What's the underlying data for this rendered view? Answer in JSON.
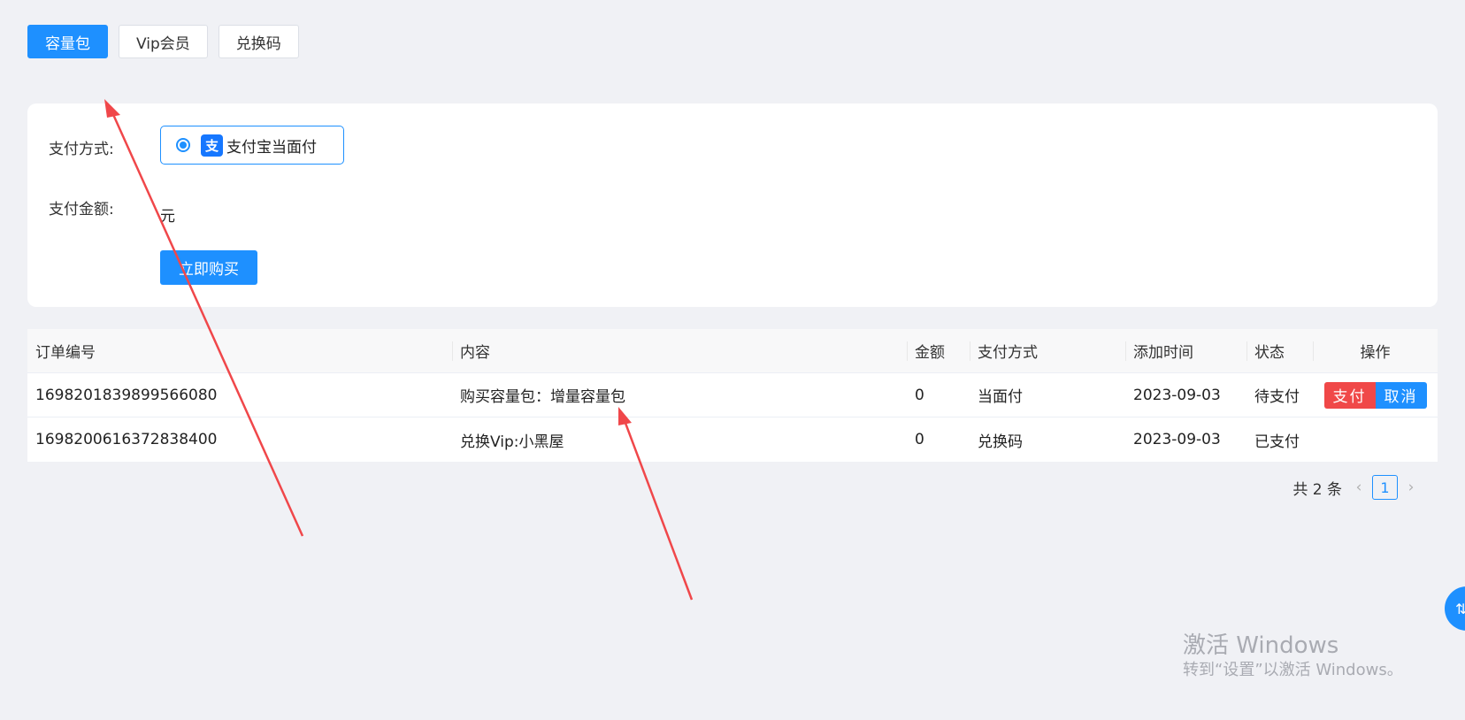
{
  "tabs": [
    {
      "label": "容量包",
      "active": true
    },
    {
      "label": "Vip会员",
      "active": false
    },
    {
      "label": "兑换码",
      "active": false
    }
  ],
  "payment_form": {
    "method_label": "支付方式:",
    "method_option": "支付宝当面付",
    "alipay_icon_glyph": "支",
    "amount_label": "支付金额:",
    "amount_unit": "元",
    "buy_button": "立即购买"
  },
  "orders_table": {
    "headers": [
      "订单编号",
      "内容",
      "金额",
      "支付方式",
      "添加时间",
      "状态",
      "操作"
    ],
    "rows": [
      {
        "id": "1698201839899566080",
        "content": "购买容量包：增量容量包",
        "amount": "0",
        "method": "当面付",
        "time": "2023-09-03",
        "status": "待支付",
        "pay_label": "支付",
        "cancel_label": "取消"
      },
      {
        "id": "1698200616372838400",
        "content": "兑换Vip:小黑屋",
        "amount": "0",
        "method": "兑换码",
        "time": "2023-09-03",
        "status": "已支付"
      }
    ]
  },
  "pagination": {
    "total_text": "共 2 条",
    "current_page": "1",
    "prev_icon": "chevron-left-icon",
    "next_icon": "chevron-right-icon"
  },
  "floating_button": {
    "glyph": "⇅"
  },
  "watermark": {
    "title": "激活 Windows",
    "subtitle": "转到“设置”以激活 Windows。"
  },
  "colors": {
    "primary": "#1e90ff",
    "danger": "#f04848",
    "annotation_arrow": "#f0474a",
    "background": "#f0f1f5"
  }
}
